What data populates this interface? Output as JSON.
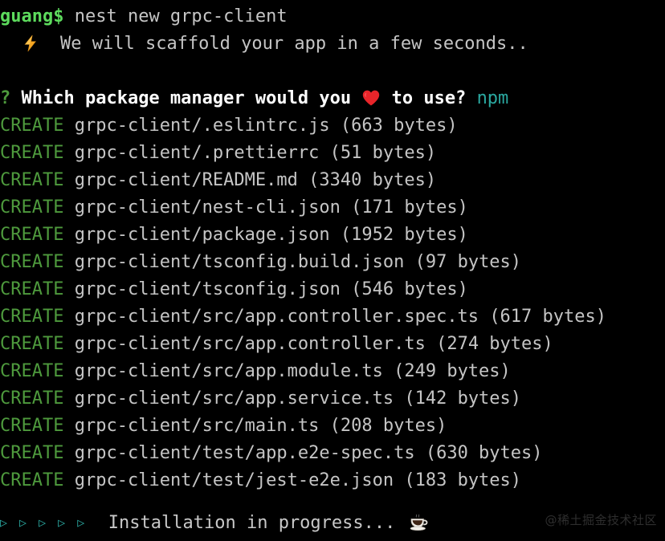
{
  "terminal": {
    "background_color": "#000000",
    "foreground_color": "#c8c8c8",
    "colors": {
      "prompt_green": "#5ddb5d",
      "create_green": "#4e9a3d",
      "answer_cyan": "#2aa8a0",
      "arrow_cyan": "#2aa8a0",
      "white": "#ffffff",
      "watermark_gray": "#2e2e2e",
      "bolt_orange": "#f5a623",
      "heart_red": "#e8252a"
    },
    "prompt": {
      "user": "guang$",
      "command": " nest new grpc-client"
    },
    "scaffold_notice": {
      "icon": "lightning-bolt-emoji",
      "indent": "  ",
      "text": "  We will scaffold your app in a few seconds.."
    },
    "question": {
      "marker": "?",
      "text_before": " Which package manager would you ",
      "icon": "red-heart-emoji",
      "text_after": " to use? ",
      "answer": "npm"
    },
    "create_label": "CREATE",
    "create_lines": [
      {
        "label": "CREATE",
        "path": "grpc-client/.eslintrc.js",
        "size": "(663 bytes)"
      },
      {
        "label": "CREATE",
        "path": "grpc-client/.prettierrc",
        "size": "(51 bytes)"
      },
      {
        "label": "CREATE",
        "path": "grpc-client/README.md",
        "size": "(3340 bytes)"
      },
      {
        "label": "CREATE",
        "path": "grpc-client/nest-cli.json",
        "size": "(171 bytes)"
      },
      {
        "label": "CREATE",
        "path": "grpc-client/package.json",
        "size": "(1952 bytes)"
      },
      {
        "label": "CREATE",
        "path": "grpc-client/tsconfig.build.json",
        "size": "(97 bytes)"
      },
      {
        "label": "CREATE",
        "path": "grpc-client/tsconfig.json",
        "size": "(546 bytes)"
      },
      {
        "label": "CREATE",
        "path": "grpc-client/src/app.controller.spec.ts",
        "size": "(617 bytes)"
      },
      {
        "label": "CREATE",
        "path": "grpc-client/src/app.controller.ts",
        "size": "(274 bytes)"
      },
      {
        "label": "CREATE",
        "path": "grpc-client/src/app.module.ts",
        "size": "(249 bytes)"
      },
      {
        "label": "CREATE",
        "path": "grpc-client/src/app.service.ts",
        "size": "(142 bytes)"
      },
      {
        "label": "CREATE",
        "path": "grpc-client/src/main.ts",
        "size": "(208 bytes)"
      },
      {
        "label": "CREATE",
        "path": "grpc-client/test/app.e2e-spec.ts",
        "size": "(630 bytes)"
      },
      {
        "label": "CREATE",
        "path": "grpc-client/test/jest-e2e.json",
        "size": "(183 bytes)"
      }
    ],
    "progress": {
      "arrows": "▷ ▷ ▷ ▷ ▷",
      "text": "  Installation in progress... ",
      "icon": "coffee-cup-emoji"
    },
    "watermark": "@稀土掘金技术社区"
  }
}
